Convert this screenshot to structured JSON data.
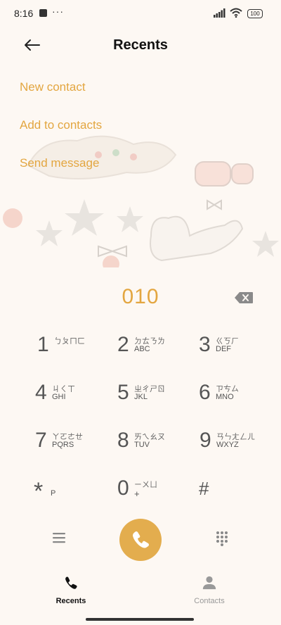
{
  "status_bar": {
    "time": "8:16",
    "dots": "···",
    "battery": "100"
  },
  "header": {
    "title": "Recents"
  },
  "actions": [
    {
      "label": "New contact"
    },
    {
      "label": "Add to contacts"
    },
    {
      "label": "Send message"
    }
  ],
  "dialer": {
    "number": "010",
    "keys": [
      {
        "digit": "1",
        "bopomofo": "ㄅㄆㄇㄈ",
        "letters": ""
      },
      {
        "digit": "2",
        "bopomofo": "ㄉㄊㄋㄌ",
        "letters": "ABC"
      },
      {
        "digit": "3",
        "bopomofo": "ㄍㄎㄏ",
        "letters": "DEF"
      },
      {
        "digit": "4",
        "bopomofo": "ㄐㄑㄒ",
        "letters": "GHI"
      },
      {
        "digit": "5",
        "bopomofo": "ㄓㄔㄕㄖ",
        "letters": "JKL"
      },
      {
        "digit": "6",
        "bopomofo": "ㄗㄘㄙ",
        "letters": "MNO"
      },
      {
        "digit": "7",
        "bopomofo": "ㄚㄛㄜㄝ",
        "letters": "PQRS"
      },
      {
        "digit": "8",
        "bopomofo": "ㄞㄟㄠㄡ",
        "letters": "TUV"
      },
      {
        "digit": "9",
        "bopomofo": "ㄢㄣㄤㄥㄦ",
        "letters": "WXYZ"
      }
    ],
    "star": {
      "digit": "*",
      "letters": "P"
    },
    "zero": {
      "digit": "0",
      "bopomofo": "ㄧㄨㄩ",
      "letters": "+"
    },
    "hash": {
      "digit": "#"
    }
  },
  "bottom_nav": [
    {
      "label": "Recents",
      "icon": "phone-icon",
      "active": true
    },
    {
      "label": "Contacts",
      "icon": "person-icon",
      "active": false
    }
  ],
  "colors": {
    "accent": "#e3a640",
    "background": "#fdf8f3",
    "call_button": "#e3ad4e"
  }
}
